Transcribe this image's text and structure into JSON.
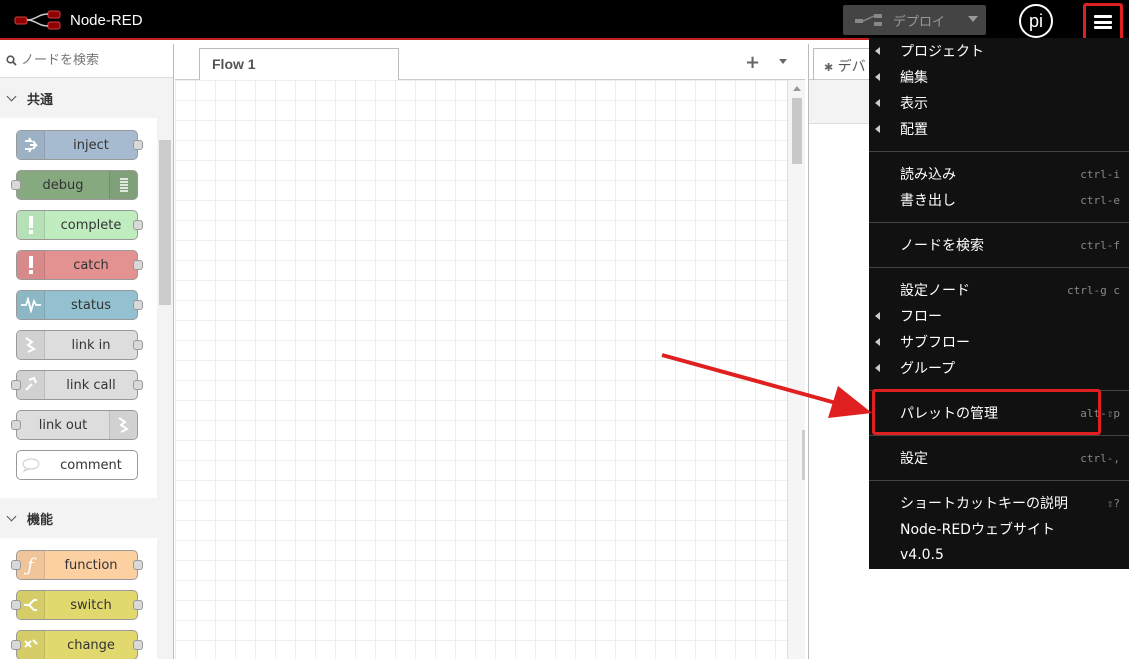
{
  "header": {
    "app_title": "Node-RED",
    "deploy_label": "デプロイ",
    "user_initials": "pi"
  },
  "palette": {
    "search_placeholder": "ノードを検索",
    "categories": [
      {
        "name": "共通",
        "nodes": [
          {
            "label": "inject",
            "color": "#a6bbcf",
            "icon": "arrow-right-icon"
          },
          {
            "label": "debug",
            "color": "#87a980",
            "icon": "list-icon"
          },
          {
            "label": "complete",
            "color": "#c0edc0",
            "icon": "exclamation-icon"
          },
          {
            "label": "catch",
            "color": "#e49191",
            "icon": "exclamation-icon"
          },
          {
            "label": "status",
            "color": "#94c1d0",
            "icon": "pulse-icon"
          },
          {
            "label": "link in",
            "color": "#dddddd",
            "icon": "link-in-icon"
          },
          {
            "label": "link call",
            "color": "#dddddd",
            "icon": "link-call-icon"
          },
          {
            "label": "link out",
            "color": "#dddddd",
            "icon": "link-out-icon"
          },
          {
            "label": "comment",
            "color": "#ffffff",
            "icon": "comment-icon"
          }
        ]
      },
      {
        "name": "機能",
        "nodes": [
          {
            "label": "function",
            "color": "#fdd0a2",
            "icon": "function-icon"
          },
          {
            "label": "switch",
            "color": "#e2d96e",
            "icon": "switch-icon"
          },
          {
            "label": "change",
            "color": "#e2d96e",
            "icon": "change-icon"
          }
        ]
      }
    ]
  },
  "workspace": {
    "tabs": [
      {
        "label": "Flow 1"
      }
    ],
    "add_tab": "+"
  },
  "sidebar": {
    "tab_label": "デバ"
  },
  "menu": {
    "items": [
      {
        "label": "プロジェクト",
        "submenu": true,
        "shortcut": ""
      },
      {
        "label": "編集",
        "submenu": true,
        "shortcut": ""
      },
      {
        "label": "表示",
        "submenu": true,
        "shortcut": ""
      },
      {
        "label": "配置",
        "submenu": true,
        "shortcut": ""
      },
      {
        "label": "読み込み",
        "submenu": false,
        "shortcut": "ctrl-i"
      },
      {
        "label": "書き出し",
        "submenu": false,
        "shortcut": "ctrl-e"
      },
      {
        "label": "ノードを検索",
        "submenu": false,
        "shortcut": "ctrl-f"
      },
      {
        "label": "設定ノード",
        "submenu": false,
        "shortcut": "ctrl-g c"
      },
      {
        "label": "フロー",
        "submenu": true,
        "shortcut": ""
      },
      {
        "label": "サブフロー",
        "submenu": true,
        "shortcut": ""
      },
      {
        "label": "グループ",
        "submenu": true,
        "shortcut": ""
      },
      {
        "label": "パレットの管理",
        "submenu": false,
        "shortcut": "alt-⇧p"
      },
      {
        "label": "設定",
        "submenu": false,
        "shortcut": "ctrl-,"
      },
      {
        "label": "ショートカットキーの説明",
        "submenu": false,
        "shortcut": "⇧?"
      },
      {
        "label": "Node-REDウェブサイト",
        "submenu": false,
        "shortcut": ""
      },
      {
        "label": "v4.0.5",
        "submenu": false,
        "shortcut": ""
      }
    ]
  },
  "annotation": {
    "highlight_color": "#e02020"
  }
}
